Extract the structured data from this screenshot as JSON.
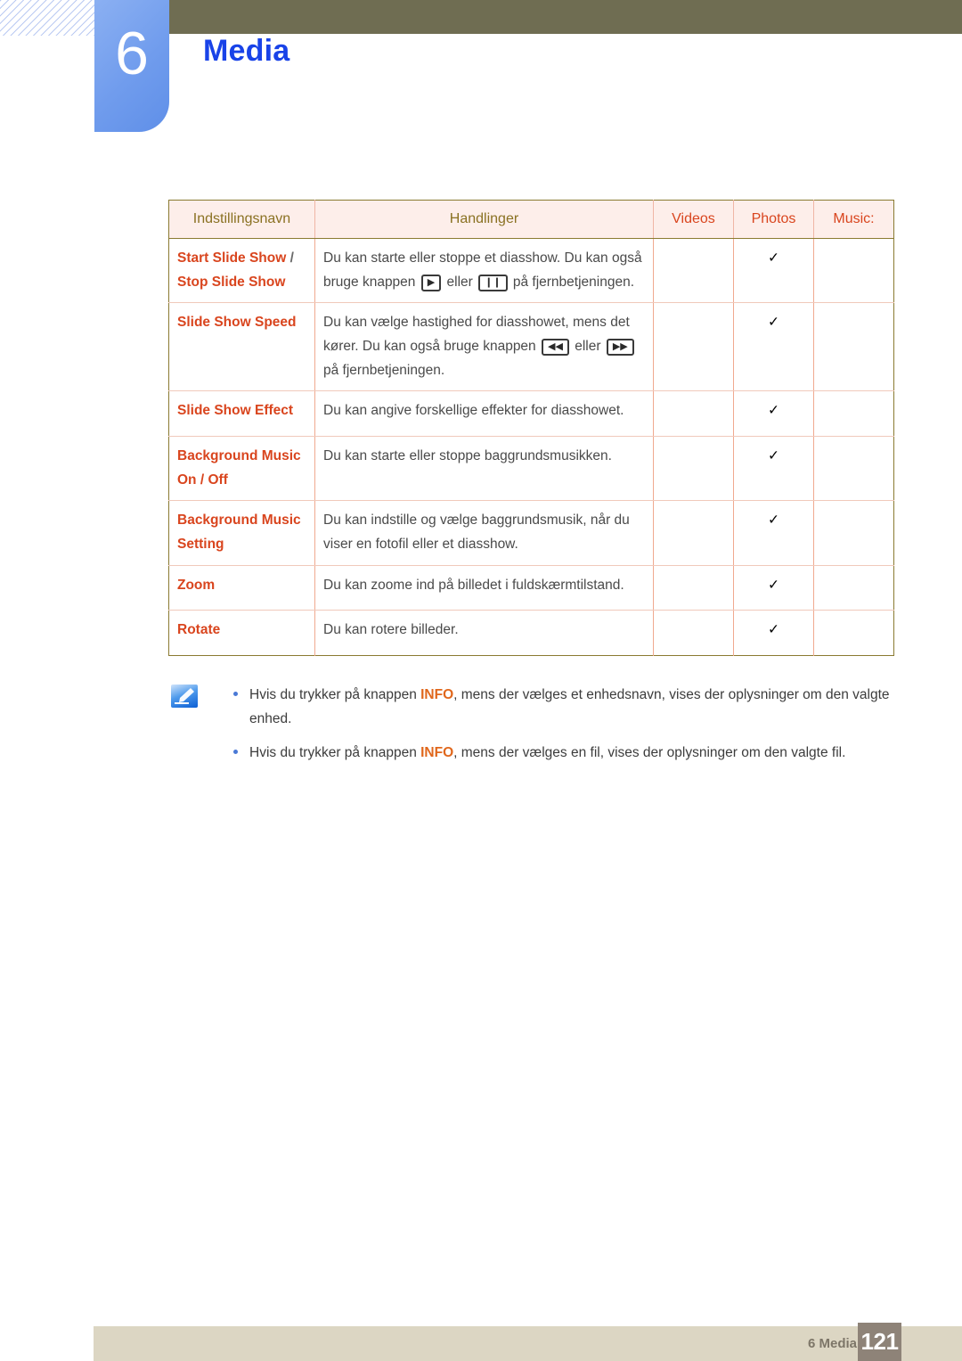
{
  "header": {
    "chapter_number": "6",
    "chapter_title": "Media",
    "accent_blue": "#1943e8",
    "badge_blue": "#709ced",
    "bar_olive": "#6f6d52"
  },
  "table": {
    "columns": [
      {
        "label": "Indstillingsnavn",
        "color": "#8a7122"
      },
      {
        "label": "Handlinger",
        "color": "#8a7122"
      },
      {
        "label": "Videos",
        "color": "#d9451e"
      },
      {
        "label": "Photos",
        "color": "#d9451e"
      },
      {
        "label": "Music:",
        "color": "#d9451e"
      }
    ],
    "rows": [
      {
        "name_parts": [
          "Start Slide Show",
          " / ",
          "Stop Slide Show"
        ],
        "name_plain": "Start Slide Show / Stop Slide Show",
        "desc_pre": "Du kan starte eller stoppe et diasshow. Du kan også bruge knappen ",
        "key1": "play-button",
        "key1_glyph": "▶",
        "desc_mid": " eller ",
        "key2": "pause-button",
        "key2_glyph": "❙❙",
        "desc_post": " på fjernbetjeningen.",
        "videos": "",
        "photos": "✓",
        "music": ""
      },
      {
        "name_plain": "Slide Show Speed",
        "desc_pre": "Du kan vælge hastighed for diasshowet, mens det kører. Du kan også bruge knappen ",
        "key1": "rewind-button",
        "key1_glyph": "◀◀",
        "desc_mid": " eller ",
        "key2": "fast-forward-button",
        "key2_glyph": "▶▶",
        "desc_post": " på fjernbetjeningen.",
        "videos": "",
        "photos": "✓",
        "music": ""
      },
      {
        "name_plain": "Slide Show Effect",
        "desc_pre": "Du kan angive forskellige effekter for diasshowet.",
        "videos": "",
        "photos": "✓",
        "music": ""
      },
      {
        "name_plain": "Background Music On / Off",
        "desc_pre": "Du kan starte eller stoppe baggrundsmusikken.",
        "videos": "",
        "photos": "✓",
        "music": ""
      },
      {
        "name_plain": "Background Music Setting",
        "desc_pre": "Du kan indstille og vælge baggrundsmusik, når du viser en fotofil eller et diasshow.",
        "videos": "",
        "photos": "✓",
        "music": ""
      },
      {
        "name_plain": "Zoom",
        "desc_pre": "Du kan zoome ind på billedet i fuldskærmtilstand.",
        "videos": "",
        "photos": "✓",
        "music": ""
      },
      {
        "name_plain": "Rotate",
        "desc_pre": "Du kan rotere billeder.",
        "videos": "",
        "photos": "✓",
        "music": ""
      }
    ]
  },
  "notes": {
    "icon_name": "note-pencil-icon",
    "items": [
      {
        "pre": "Hvis du trykker på knappen ",
        "emph": "INFO",
        "post": ", mens der vælges et enhedsnavn, vises der oplysninger om den valgte enhed."
      },
      {
        "pre": "Hvis du trykker på knappen ",
        "emph": "INFO",
        "post": ", mens der vælges en fil, vises der oplysninger om den valgte fil."
      }
    ]
  },
  "footer": {
    "label": "6 Media",
    "page_number": "121",
    "bar_color": "#dcd6c3",
    "page_box_color": "#8e8378"
  }
}
